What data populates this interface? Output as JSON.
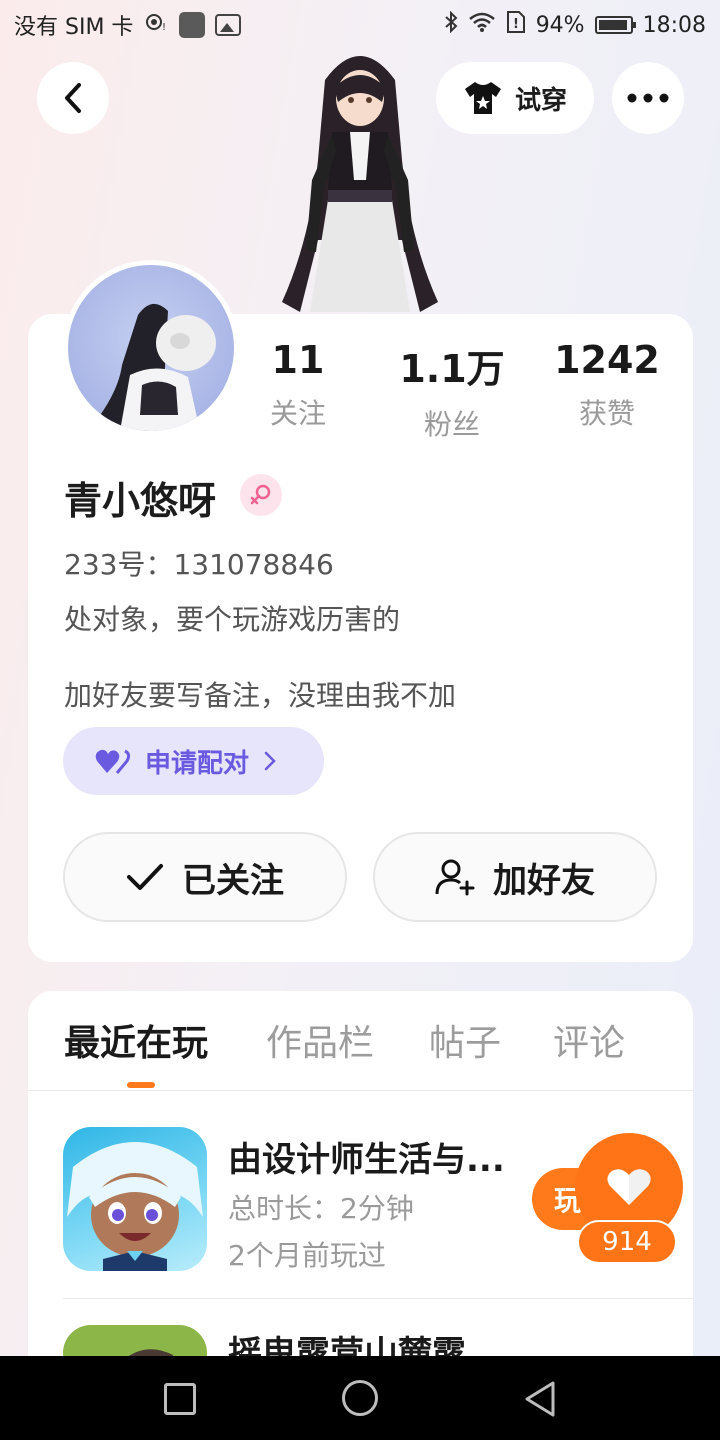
{
  "status_bar": {
    "carrier": "没有 SIM 卡",
    "battery": "94%",
    "time": "18:08"
  },
  "header": {
    "try_on_label": "试穿"
  },
  "profile": {
    "stats": [
      {
        "value": "11",
        "label": "关注"
      },
      {
        "value": "1.1万",
        "label": "粉丝"
      },
      {
        "value": "1242",
        "label": "获赞"
      }
    ],
    "name": "青小悠呀",
    "id_line": "233号：131078846",
    "bio_line1": "处对象，要个玩游戏历害的",
    "bio_line2": "加好友要写备注，没理由我不加",
    "pair_label": "申请配对",
    "follow_label": "已关注",
    "add_friend_label": "加好友"
  },
  "tabs": [
    {
      "label": "最近在玩",
      "active": true
    },
    {
      "label": "作品栏",
      "active": false
    },
    {
      "label": "帖子",
      "active": false
    },
    {
      "label": "评论",
      "active": false
    }
  ],
  "games": [
    {
      "title": "由设计师生活与...",
      "duration": "总时长：2分钟",
      "last_played": "2个月前玩过",
      "play_label": "玩"
    },
    {
      "title": "摇曳露营山麓露"
    }
  ],
  "like_fab": {
    "count": "914"
  },
  "colors": {
    "accent": "#ff7a1a",
    "pair_bg": "#e7e5fb",
    "pair_text": "#6a5ae0",
    "gender_pink": "#f06292"
  }
}
